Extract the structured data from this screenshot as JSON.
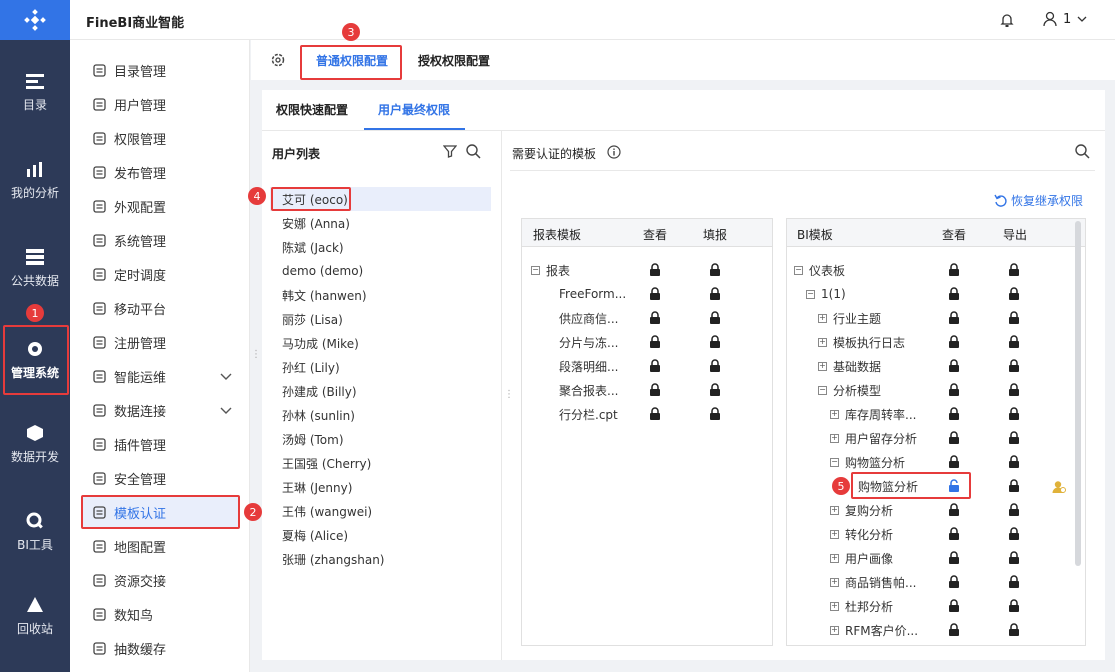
{
  "app": {
    "title": "FineBI商业智能",
    "user": "1"
  },
  "nav": [
    {
      "label": "目录",
      "icon": "catalog-icon"
    },
    {
      "label": "我的分析",
      "icon": "analysis-icon"
    },
    {
      "label": "公共数据",
      "icon": "public-data-icon"
    },
    {
      "label": "管理系统",
      "icon": "manage-system-icon"
    },
    {
      "label": "数据开发",
      "icon": "data-dev-icon"
    },
    {
      "label": "BI工具",
      "icon": "bi-tool-icon"
    },
    {
      "label": "回收站",
      "icon": "recycle-icon"
    }
  ],
  "sidebar": [
    {
      "label": "目录管理"
    },
    {
      "label": "用户管理"
    },
    {
      "label": "权限管理"
    },
    {
      "label": "发布管理"
    },
    {
      "label": "外观配置"
    },
    {
      "label": "系统管理"
    },
    {
      "label": "定时调度"
    },
    {
      "label": "移动平台"
    },
    {
      "label": "注册管理"
    },
    {
      "label": "智能运维"
    },
    {
      "label": "数据连接"
    },
    {
      "label": "插件管理"
    },
    {
      "label": "安全管理"
    },
    {
      "label": "模板认证"
    },
    {
      "label": "地图配置"
    },
    {
      "label": "资源交接"
    },
    {
      "label": "数知鸟"
    },
    {
      "label": "抽数缓存"
    }
  ],
  "tabs": {
    "general": "普通权限配置",
    "auth": "授权权限配置"
  },
  "subtabs": {
    "quick": "权限快速配置",
    "final": "用户最终权限"
  },
  "userlist": {
    "title": "用户列表",
    "users": [
      "艾可 (eoco)",
      "安娜 (Anna)",
      "陈斌 (Jack)",
      "demo (demo)",
      "韩文 (hanwen)",
      "丽莎 (Lisa)",
      "马功成 (Mike)",
      "孙红 (Lily)",
      "孙建成 (Billy)",
      "孙林 (sunlin)",
      "汤姆 (Tom)",
      "王国强 (Cherry)",
      "王琳 (Jenny)",
      "王伟 (wangwei)",
      "夏梅 (Alice)",
      "张珊 (zhangshan)"
    ]
  },
  "right": {
    "title": "需要认证的模板",
    "restore": "恢复继承权限"
  },
  "report": {
    "headers": [
      "报表模板",
      "查看",
      "填报"
    ],
    "rows": [
      "报表",
      "FreeForm...",
      "供应商信...",
      "分片与冻...",
      "段落明细...",
      "聚合报表...",
      "行分栏.cpt"
    ]
  },
  "bi": {
    "headers": [
      "BI模板",
      "查看",
      "导出"
    ],
    "rows": [
      "仪表板",
      "1(1)",
      "行业主题",
      "模板执行日志",
      "基础数据",
      "分析模型",
      "库存周转率...",
      "用户留存分析",
      "购物篮分析",
      "购物篮分析",
      "复购分析",
      "转化分析",
      "用户画像",
      "商品销售帕...",
      "杜邦分析",
      "RFM客户价..."
    ]
  },
  "badges": [
    "1",
    "2",
    "3",
    "4",
    "5"
  ],
  "colors": {
    "accent": "#3274e6",
    "nav_bg": "#2d3a58",
    "highlight": "#e63b3b"
  }
}
